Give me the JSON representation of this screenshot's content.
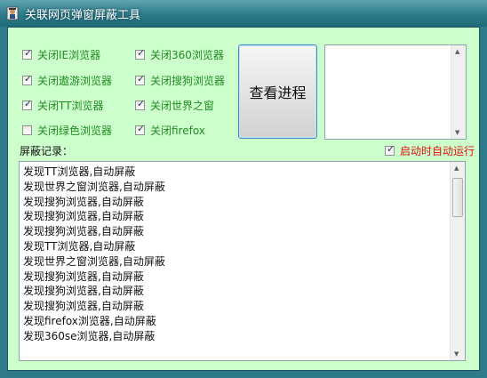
{
  "window": {
    "title": "关联网页弹窗屏蔽工具"
  },
  "checkboxes": [
    {
      "label": "关闭IE浏览器",
      "checked": true
    },
    {
      "label": "关闭360浏览器",
      "checked": true
    },
    {
      "label": "关闭遨游浏览器",
      "checked": true
    },
    {
      "label": "关闭搜狗浏览器",
      "checked": true
    },
    {
      "label": "关闭TT浏览器",
      "checked": true
    },
    {
      "label": "关闭世界之窗",
      "checked": true
    },
    {
      "label": "关闭绿色浏览器",
      "checked": false
    },
    {
      "label": "关闭firefox",
      "checked": true
    }
  ],
  "view_process_button": "查看进程",
  "log": {
    "label": "屏蔽记录：",
    "entries": [
      "发现TT浏览器,自动屏蔽",
      "发现世界之窗浏览器,自动屏蔽",
      "发现搜狗浏览器,自动屏蔽",
      "发现搜狗浏览器,自动屏蔽",
      "发现搜狗浏览器,自动屏蔽",
      "发现TT浏览器,自动屏蔽",
      "发现世界之窗浏览器,自动屏蔽",
      "发现搜狗浏览器,自动屏蔽",
      "发现搜狗浏览器,自动屏蔽",
      "发现搜狗浏览器,自动屏蔽",
      "发现firefox浏览器,自动屏蔽",
      "发现360se浏览器,自动屏蔽"
    ]
  },
  "autorun": {
    "label": "启动时自动运行",
    "checked": true
  },
  "colors": {
    "label_green": "#228b22",
    "autorun_red": "#e01010",
    "client_bg": "#ccffcc",
    "titlebar": "#2c7b8a"
  }
}
